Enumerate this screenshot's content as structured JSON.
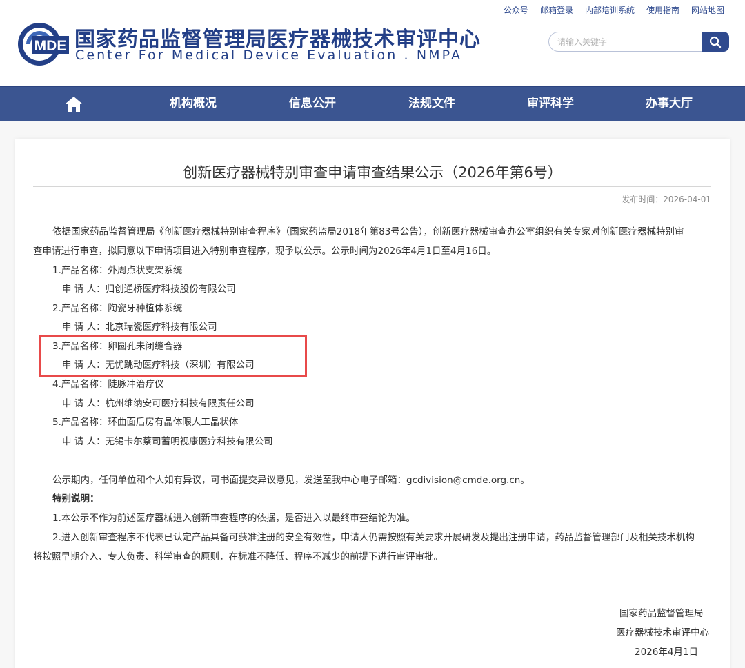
{
  "toplinks": [
    "公众号",
    "邮箱登录",
    "内部培训系统",
    "使用指南",
    "网站地图"
  ],
  "logo": {
    "text": "MDE"
  },
  "header": {
    "title_cn": "国家药品监督管理局医疗器械技术审评中心",
    "title_en": "Center For Medical Device Evaluation . NMPA"
  },
  "search": {
    "placeholder": "请输入关键字"
  },
  "nav": {
    "items": [
      "机构概况",
      "信息公开",
      "法规文件",
      "审评科学",
      "办事大厅"
    ]
  },
  "article": {
    "title": "创新医疗器械特别审查申请审查结果公示（2026年第6号）",
    "pubdate": "发布时间：2026-04-01",
    "intro_1": "依据国家药品监督管理局《创新医疗器械特别审查程序》（国家药监局2018年第83号公告），创新医疗器械审查办公室组织有关专家对创新医疗器械特别审",
    "intro_2": "查申请进行审查，拟同意以下申请项目进入特别审查程序，现予以公示。公示时间为2026年4月1日至4月16日。",
    "items": [
      {
        "product": "1.产品名称：外周点状支架系统",
        "applicant": "申 请 人：归创通桥医疗科技股份有限公司"
      },
      {
        "product": "2.产品名称：陶瓷牙种植体系统",
        "applicant": "申 请 人：北京瑞瓷医疗科技有限公司"
      },
      {
        "product": "3.产品名称：卵圆孔未闭缝合器",
        "applicant": "申 请 人：无忧跳动医疗科技（深圳）有限公司"
      },
      {
        "product": "4.产品名称：陡脉冲治疗仪",
        "applicant": "申 请 人：杭州维纳安可医疗科技有限责任公司"
      },
      {
        "product": "5.产品名称：环曲面后房有晶体眼人工晶状体",
        "applicant": "申 请 人：无锡卡尔蔡司蓄明视康医疗科技有限公司"
      }
    ],
    "objection": "公示期内，任何单位和个人如有异议，可书面提交异议意见，发送至我中心电子邮箱：gcdivision@cmde.org.cn。",
    "special_heading": "特别说明：",
    "note_1": "1.本公示不作为前述医疗器械进入创新审查程序的依据，是否进入以最终审查结论为准。",
    "note_2a": "2.进入创新审查程序不代表已认定产品具备可获准注册的安全有效性，申请人仍需按照有关要求开展研发及提出注册申请，药品监督管理部门及相关技术机构",
    "note_2b": "将按照早期介入、专人负责、科学审查的原则，在标准不降低、程序不减少的前提下进行审评审批。",
    "sign_org_1": "国家药品监督管理局",
    "sign_org_2": "医疗器械技术审评中心",
    "sign_date": "2026年4月1日"
  },
  "colors": {
    "brand": "#233f87",
    "nav": "#3b5591",
    "highlight": "#e84a4a"
  }
}
